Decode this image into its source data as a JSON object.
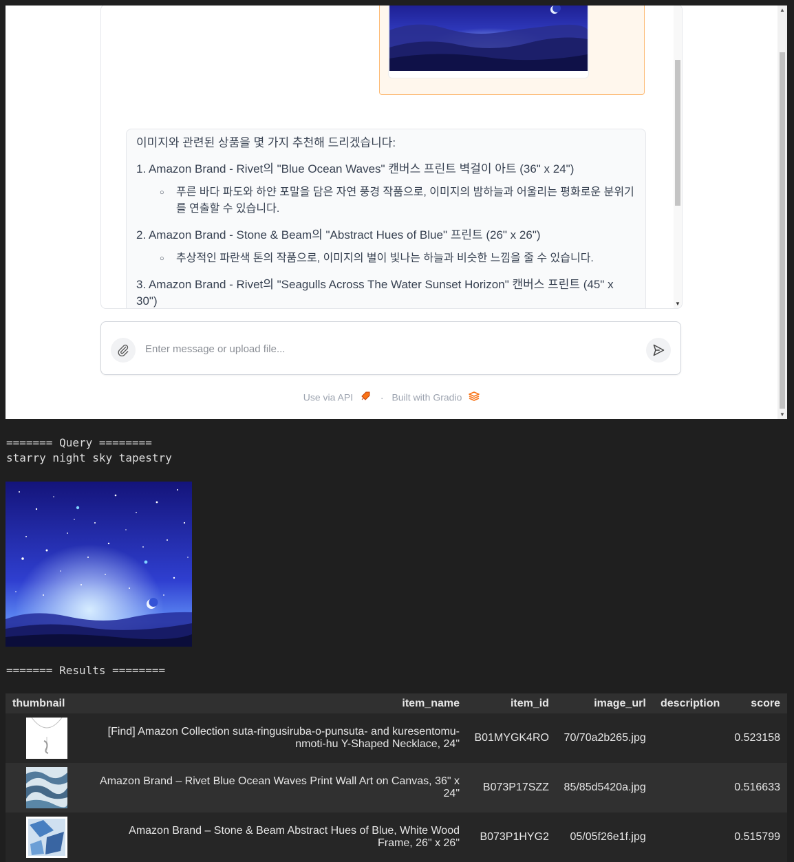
{
  "chat": {
    "bot_intro": "이미지와 관련된 상품을 몇 가지 추천해 드리겠습니다:",
    "recommendations": [
      {
        "title": "1. Amazon Brand - Rivet의 \"Blue Ocean Waves\" 캔버스 프린트 벽걸이 아트 (36\" x 24\")",
        "detail": "푸른 바다 파도와 하얀 포말을 담은 자연 풍경 작품으로, 이미지의 밤하늘과 어울리는 평화로운 분위기를 연출할 수 있습니다."
      },
      {
        "title": "2. Amazon Brand - Stone & Beam의 \"Abstract Hues of Blue\" 프린트 (26\" x 26\")",
        "detail": "추상적인 파란색 톤의 작품으로, 이미지의 별이 빛나는 하늘과 비슷한 느낌을 줄 수 있습니다."
      },
      {
        "title": "3. Amazon Brand - Rivet의 \"Seagulls Across The Water Sunset Horizon\" 캔버스 프린트 (45\" x 30\")",
        "detail": ""
      }
    ]
  },
  "input": {
    "placeholder": "Enter message or upload file..."
  },
  "footer": {
    "api_label": "Use via API",
    "separator": "·",
    "built_label": "Built with Gradio"
  },
  "console": {
    "query_heading": "======= Query ========",
    "query_text": "starry night sky tapestry",
    "results_heading": "======= Results ========"
  },
  "table": {
    "columns": [
      "thumbnail",
      "item_name",
      "item_id",
      "image_url",
      "description",
      "score"
    ],
    "rows": [
      {
        "item_name": "[Find] Amazon Collection suta-ringusiruba-o-punsuta- and kuresentomu-nmoti-hu Y-Shaped Necklace, 24\"",
        "item_id": "B01MYGK4RO",
        "image_url": "70/70a2b265.jpg",
        "description": "",
        "score": "0.523158"
      },
      {
        "item_name": "Amazon Brand – Rivet Blue Ocean Waves Print Wall Art on Canvas, 36\" x 24\"",
        "item_id": "B073P17SZZ",
        "image_url": "85/85d5420a.jpg",
        "description": "",
        "score": "0.516633"
      },
      {
        "item_name": "Amazon Brand – Stone & Beam Abstract Hues of Blue, White Wood Frame, 26\" x 26\"",
        "item_id": "B073P1HYG2",
        "image_url": "05/05f26e1f.jpg",
        "description": "",
        "score": "0.515799"
      }
    ]
  },
  "colors": {
    "user_bubble_bg": "#fff7ed",
    "user_bubble_border": "#fdba74",
    "gradio_orange": "#f97316",
    "console_bg": "#1f1f1f"
  }
}
